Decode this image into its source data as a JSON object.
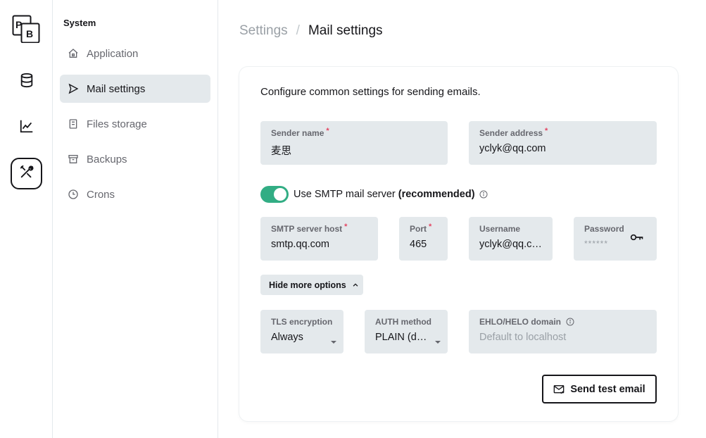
{
  "rail": {
    "logo_text": "PB",
    "items": [
      {
        "name": "collections",
        "icon": "database-icon"
      },
      {
        "name": "logs",
        "icon": "chart-line-icon"
      },
      {
        "name": "settings",
        "icon": "tools-icon",
        "active": true
      }
    ]
  },
  "sidebar": {
    "section_title": "System",
    "items": [
      {
        "label": "Application",
        "icon": "home-icon"
      },
      {
        "label": "Mail settings",
        "icon": "send-icon",
        "active": true
      },
      {
        "label": "Files storage",
        "icon": "storage-icon"
      },
      {
        "label": "Backups",
        "icon": "archive-icon"
      },
      {
        "label": "Crons",
        "icon": "clock-icon"
      }
    ]
  },
  "breadcrumb": {
    "parent": "Settings",
    "separator": "/",
    "current": "Mail settings"
  },
  "form": {
    "intro": "Configure common settings for sending emails.",
    "sender_name": {
      "label": "Sender name",
      "required": "*",
      "value": "麦思"
    },
    "sender_address": {
      "label": "Sender address",
      "required": "*",
      "value": "yclyk@qq.com"
    },
    "smtp_toggle": {
      "label": "Use SMTP mail server",
      "recommended": "(recommended)",
      "enabled": true
    },
    "smtp_host": {
      "label": "SMTP server host",
      "required": "*",
      "value": "smtp.qq.com"
    },
    "port": {
      "label": "Port",
      "required": "*",
      "value": "465"
    },
    "username": {
      "label": "Username",
      "value": "yclyk@qq.com"
    },
    "password": {
      "label": "Password",
      "value": "******"
    },
    "more_options_label": "Hide more options",
    "tls": {
      "label": "TLS encryption",
      "value": "Always"
    },
    "auth": {
      "label": "AUTH method",
      "value": "PLAIN (d…"
    },
    "ehlo": {
      "label": "EHLO/HELO domain",
      "placeholder": "Default to localhost"
    },
    "send_test_label": "Send test email"
  },
  "colors": {
    "accent_green": "#32ad84",
    "field_bg": "#e4e9ec",
    "required_red": "#e34562"
  }
}
